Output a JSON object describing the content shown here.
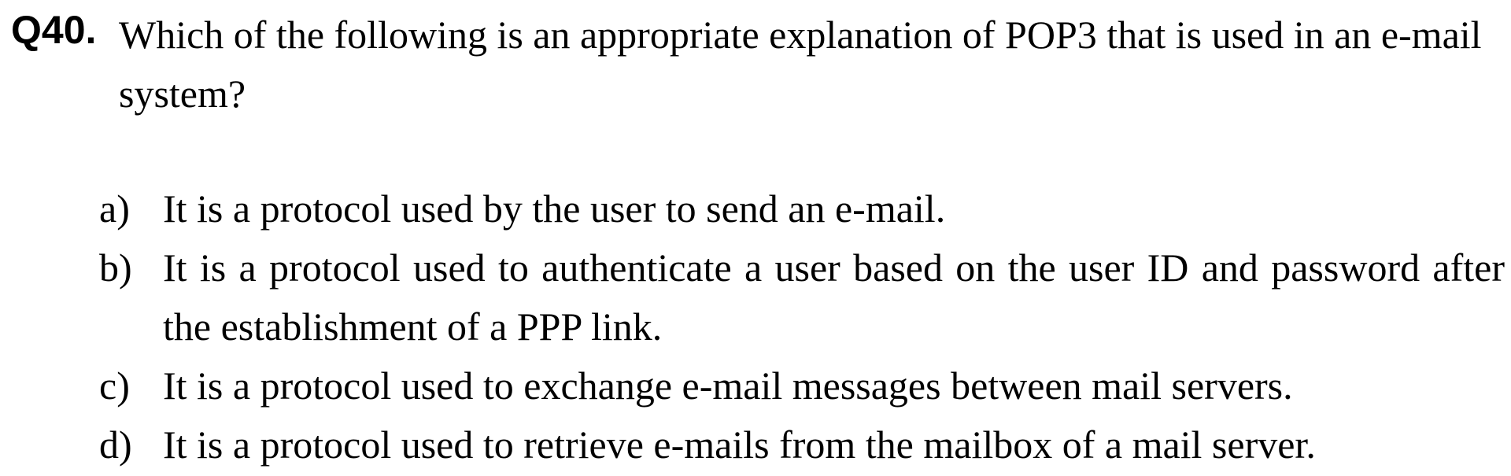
{
  "question": {
    "number": "Q40.",
    "text": "Which of the following is an appropriate explanation of POP3 that is used in an e-mail system?"
  },
  "options": [
    {
      "label": "a)",
      "text": "It is a protocol used by the user to send an e-mail."
    },
    {
      "label": "b)",
      "text": "It is a protocol used to authenticate a user based on the user ID and password after the establishment of a PPP link."
    },
    {
      "label": "c)",
      "text": "It is a protocol used to exchange e-mail messages between mail servers."
    },
    {
      "label": "d)",
      "text": "It is a protocol used to retrieve e-mails from the mailbox of a mail server."
    }
  ]
}
